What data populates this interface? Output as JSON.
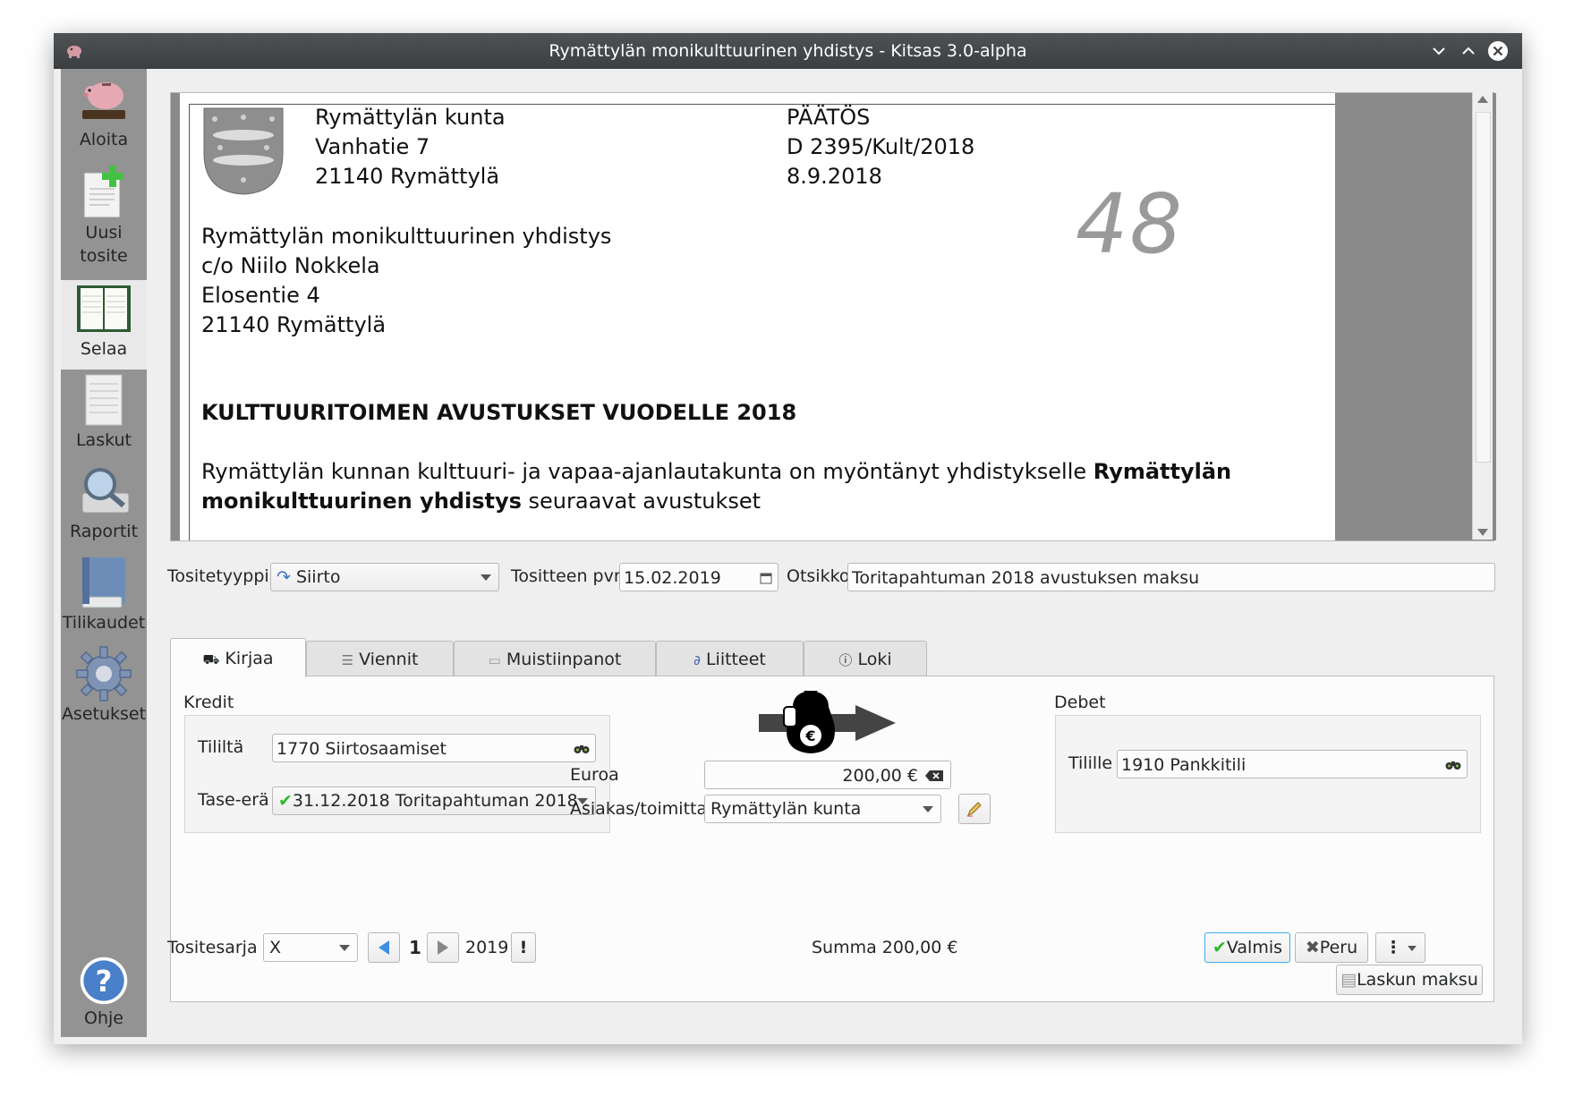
{
  "window": {
    "title": "Rymättylän monikulttuurinen yhdistys - Kitsas 3.0-alpha"
  },
  "sidebar": {
    "items": [
      {
        "label": "Aloita",
        "icon": "piggy-bank-icon"
      },
      {
        "label": "Uusi\ntosite",
        "icon": "new-document-icon"
      },
      {
        "label": "Selaa",
        "icon": "ledger-book-icon"
      },
      {
        "label": "Laskut",
        "icon": "invoice-icon"
      },
      {
        "label": "Raportit",
        "icon": "magnifier-report-icon"
      },
      {
        "label": "Tilikaudet",
        "icon": "book-icon"
      },
      {
        "label": "Asetukset",
        "icon": "gear-icon"
      }
    ],
    "help": {
      "label": "Ohje",
      "icon": "help-icon"
    }
  },
  "document": {
    "sender": [
      "Rymättylän kunta",
      "Vanhatie 7",
      "21140 Rymättylä"
    ],
    "doc_type": [
      "PÄÄTÖS",
      "D 2395/Kult/2018",
      "8.9.2018"
    ],
    "handwritten_number": "48",
    "recipient": [
      "Rymättylän monikulttuurinen yhdistys",
      "c/o Niilo Nokkela",
      "Elosentie 4",
      "21140 Rymättylä"
    ],
    "heading": "KULTTUURITOIMEN AVUSTUKSET VUODELLE 2018",
    "body_line1_pre": "Rymättylän kunnan kulttuuri- ja vapaa-ajanlautakunta on myöntänyt yhdistykselle ",
    "body_line1_bold": "Rymättylän",
    "body_line2_bold": "monikulttuurinen yhdistys",
    "body_line2_post": " seuraavat avustukset"
  },
  "form": {
    "type_label": "Tositetyyppi",
    "type_value": "Siirto",
    "date_label": "Tositteen pvm",
    "date_value": "15.02.2019",
    "title_label": "Otsikko",
    "title_value": "Toritapahtuman 2018 avustuksen maksu"
  },
  "tabs": [
    {
      "label": "Kirjaa",
      "icon": "stamp-icon"
    },
    {
      "label": "Viennit",
      "icon": "list-icon"
    },
    {
      "label": "Muistiinpanot",
      "icon": "note-icon"
    },
    {
      "label": "Liitteet",
      "icon": "paperclip-icon"
    },
    {
      "label": "Loki",
      "icon": "info-icon"
    }
  ],
  "kirjaa": {
    "kredit_label": "Kredit",
    "from_account_label": "Tililtä",
    "from_account_value": "1770 Siirtosaamiset",
    "balance_item_label": "Tase-erä",
    "balance_item_value": "31.12.2018 Toritapahtuman 2018 .",
    "euro_label": "Euroa",
    "euro_value": "200,00 €",
    "party_label": "Asiakas/toimittaja",
    "party_value": "Rymättylän kunta",
    "debet_label": "Debet",
    "to_account_label": "Tilille",
    "to_account_value": "1910 Pankkitili",
    "invoice_payment_button": "Laskun maksu"
  },
  "footer": {
    "series_label": "Tositesarja",
    "series_value": "X",
    "number": "1",
    "year": "2019",
    "sum": "Summa 200,00 €",
    "ok_button": "Valmis",
    "cancel_button": "Peru"
  },
  "colors": {
    "titlebar": "#3c3f42",
    "sidebar": "#939393",
    "accent": "#3daee9",
    "check": "#2eb82e"
  }
}
